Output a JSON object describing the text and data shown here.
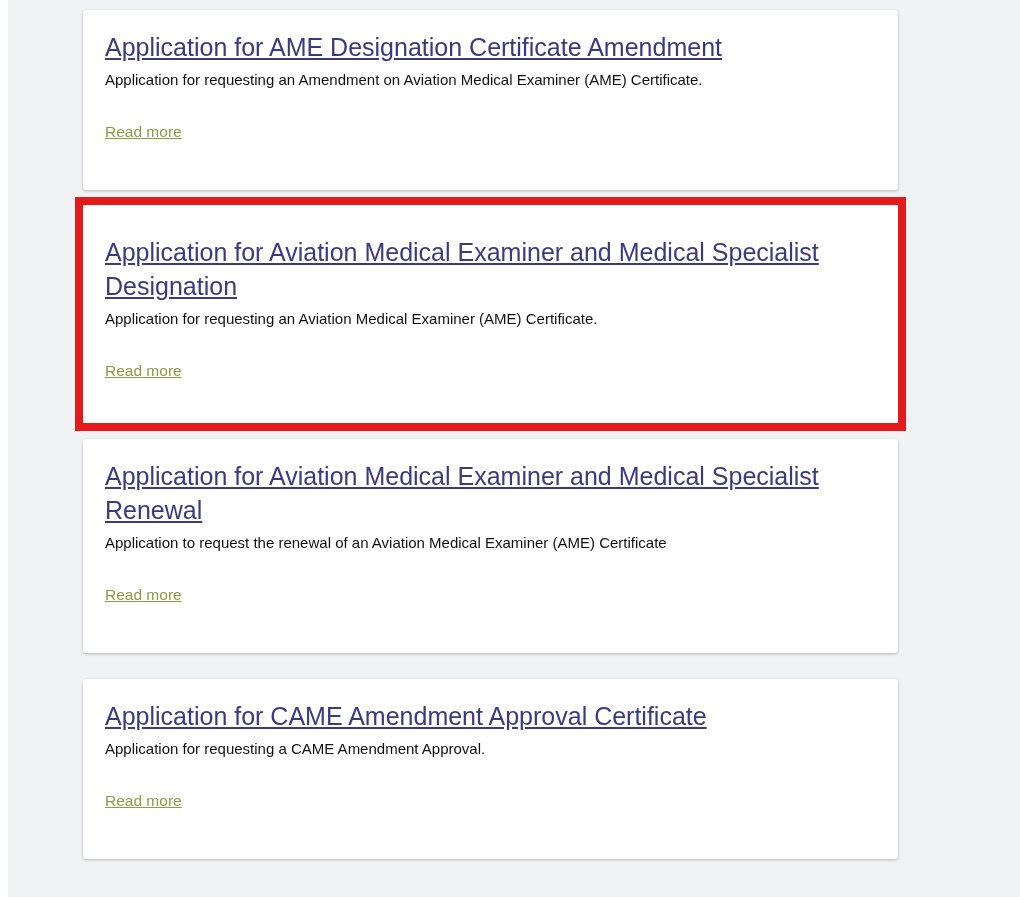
{
  "cards": [
    {
      "title": "Application for AME Designation Certificate Amendment",
      "description": "Application for requesting an Amendment on Aviation Medical Examiner (AME) Certificate.",
      "link": "Read more",
      "highlighted": false
    },
    {
      "title": "Application for Aviation Medical Examiner and Medical Specialist Designation",
      "description": "Application for requesting an Aviation Medical Examiner (AME) Certificate.",
      "link": "Read more",
      "highlighted": true
    },
    {
      "title": "Application for Aviation Medical Examiner and Medical Specialist Renewal",
      "description": "Application to request the renewal of an Aviation Medical Examiner (AME) Certificate",
      "link": "Read more",
      "highlighted": false
    },
    {
      "title": "Application for CAME Amendment Approval Certificate",
      "description": "Application for requesting a CAME Amendment Approval.",
      "link": "Read more",
      "highlighted": false
    }
  ]
}
